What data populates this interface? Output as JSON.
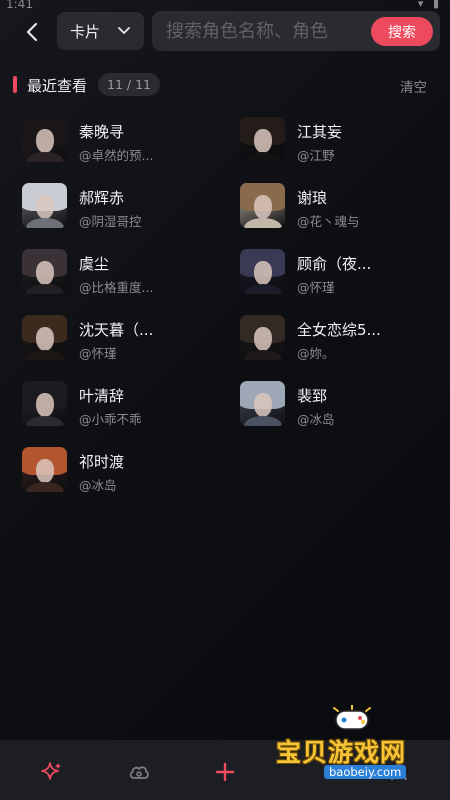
{
  "status": {
    "time": "1:41"
  },
  "header": {
    "type_select": {
      "label": "卡片"
    },
    "search": {
      "placeholder": "搜索角色名称、角色",
      "button_label": "搜索"
    }
  },
  "section": {
    "title": "最近查看",
    "count": "11 / 11",
    "clear_label": "清空"
  },
  "characters": [
    {
      "name": "秦晚寻",
      "author": "@卓然的预...",
      "hair": "#1a1618",
      "shoulder": "#2b2226"
    },
    {
      "name": "江其妄",
      "author": "@江野",
      "hair": "#241c18",
      "shoulder": "#121114"
    },
    {
      "name": "郝辉赤",
      "author": "@阴湿哥控",
      "hair": "#c9ccd3",
      "shoulder": "#6e7078"
    },
    {
      "name": "谢琅",
      "author": "@花丶魂与",
      "hair": "#8a6a4c",
      "shoulder": "#c3b7a8"
    },
    {
      "name": "虞尘",
      "author": "@比格重度...",
      "hair": "#3a3236",
      "shoulder": "#232024"
    },
    {
      "name": "顾俞（夜...",
      "author": "@怀瑾",
      "hair": "#3b3a55",
      "shoulder": "#1c1b2a"
    },
    {
      "name": "沈天暮（...",
      "author": "@怀瑾",
      "hair": "#3d2a1e",
      "shoulder": "#1d1714"
    },
    {
      "name": "全女恋综5...",
      "author": "@妳。",
      "hair": "#332a26",
      "shoulder": "#1e1a19"
    },
    {
      "name": "叶清辞",
      "author": "@小乖不乖",
      "hair": "#1b1b20",
      "shoulder": "#2a2a30"
    },
    {
      "name": "裴郅",
      "author": "@冰岛",
      "hair": "#9ea7b6",
      "shoulder": "#4a5160"
    },
    {
      "name": "祁时渡",
      "author": "@冰岛",
      "hair": "#b3552e",
      "shoulder": "#3a2620"
    }
  ],
  "bottom_nav": [
    {
      "icon": "sparkle-icon",
      "color": "#ee4a5e"
    },
    {
      "icon": "cloud-icon",
      "color": "#7c7d85"
    },
    {
      "icon": "plus-icon",
      "color": "#ee4a5e"
    },
    {
      "icon": "user-icon",
      "color": "#7c7d85"
    }
  ],
  "watermark": {
    "text": "宝贝游戏网",
    "url": "baobeiy.com"
  },
  "colors": {
    "accent": "#ee4a5e",
    "background": "#0f1014",
    "panel": "#2a2b31"
  }
}
